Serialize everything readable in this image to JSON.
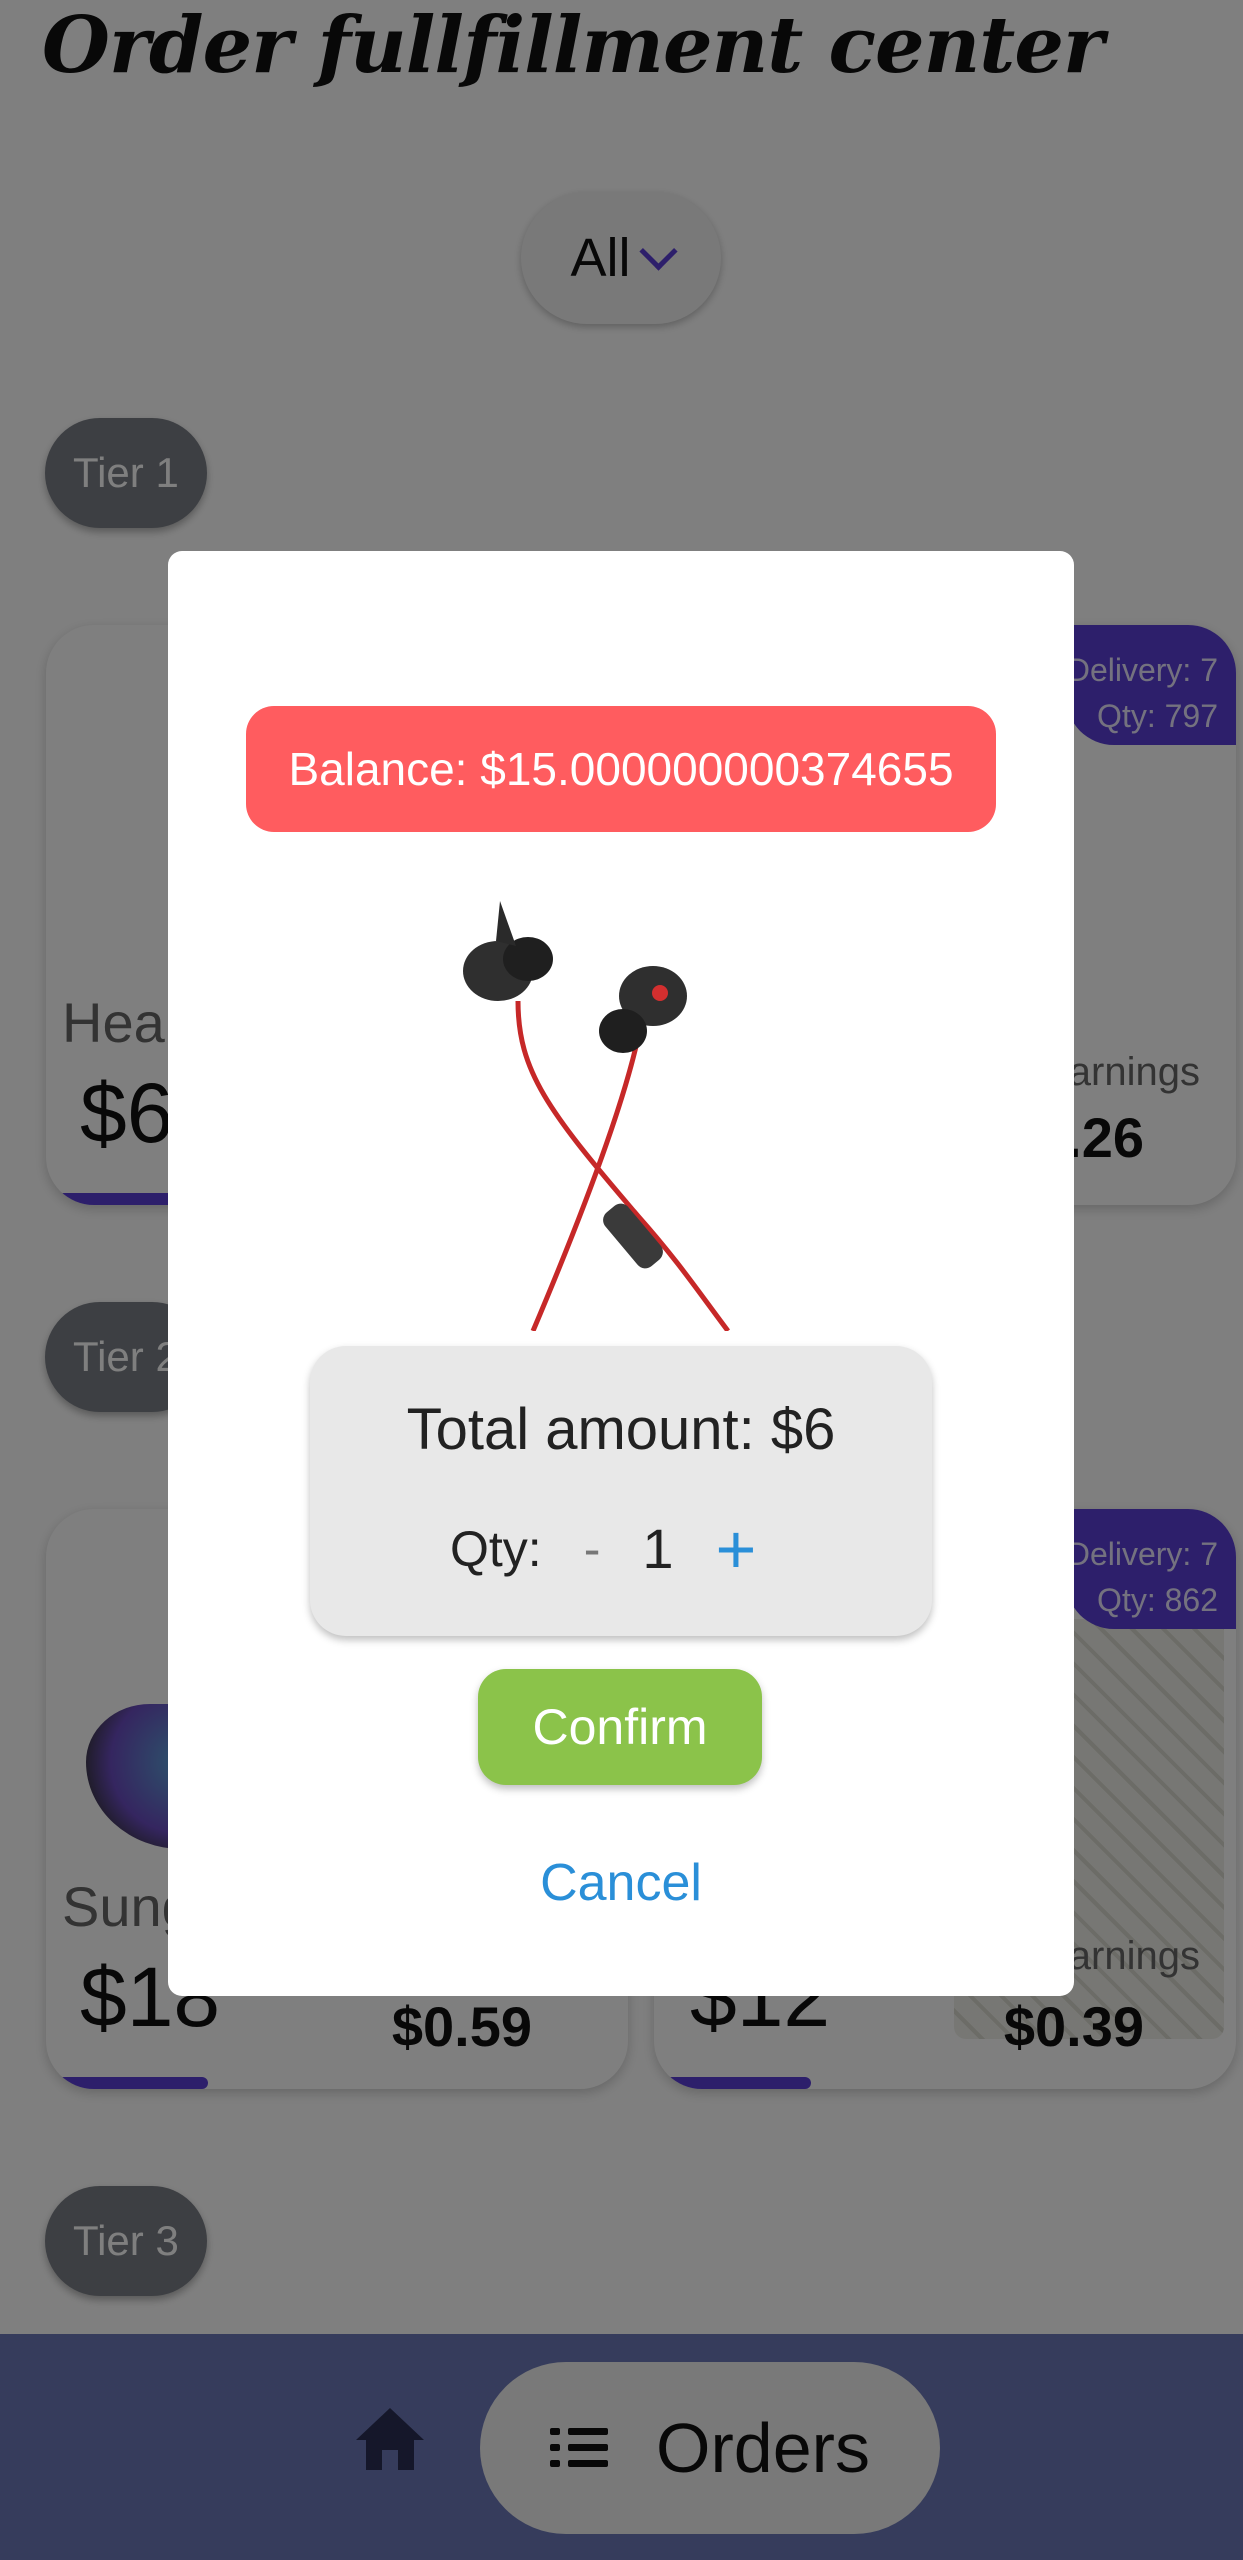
{
  "header": {
    "title": "Order fullfillment center"
  },
  "filter": {
    "selected": "All"
  },
  "tiers": [
    {
      "label": "Tier 1"
    },
    {
      "label": "Tier 2"
    },
    {
      "label": "Tier 3"
    }
  ],
  "products": [
    {
      "name": "Hea",
      "price": "$6"
    },
    {
      "delivery": "Delivery: 7",
      "qty": "Qty: 797",
      "earnings_label": "arnings",
      "earnings": ".26"
    },
    {
      "name": "Sung",
      "price": "$18",
      "earnings": "$0.59"
    },
    {
      "delivery": "Delivery: 7",
      "qty": "Qty: 862",
      "price": "$12",
      "earnings_label": "arnings",
      "earnings": "$0.39"
    }
  ],
  "modal": {
    "balance": "Balance: $15.000000000374655",
    "total": "Total amount: $6",
    "qty_label": "Qty:",
    "minus": "-",
    "qty_value": "1",
    "plus": "+",
    "confirm": "Confirm",
    "cancel": "Cancel"
  },
  "bottom_nav": {
    "orders_label": "Orders"
  },
  "colors": {
    "accent": "#5b3fd6",
    "balance_bg": "#ff5c5f",
    "confirm_bg": "#8bc34a",
    "link": "#2a8fd8"
  }
}
